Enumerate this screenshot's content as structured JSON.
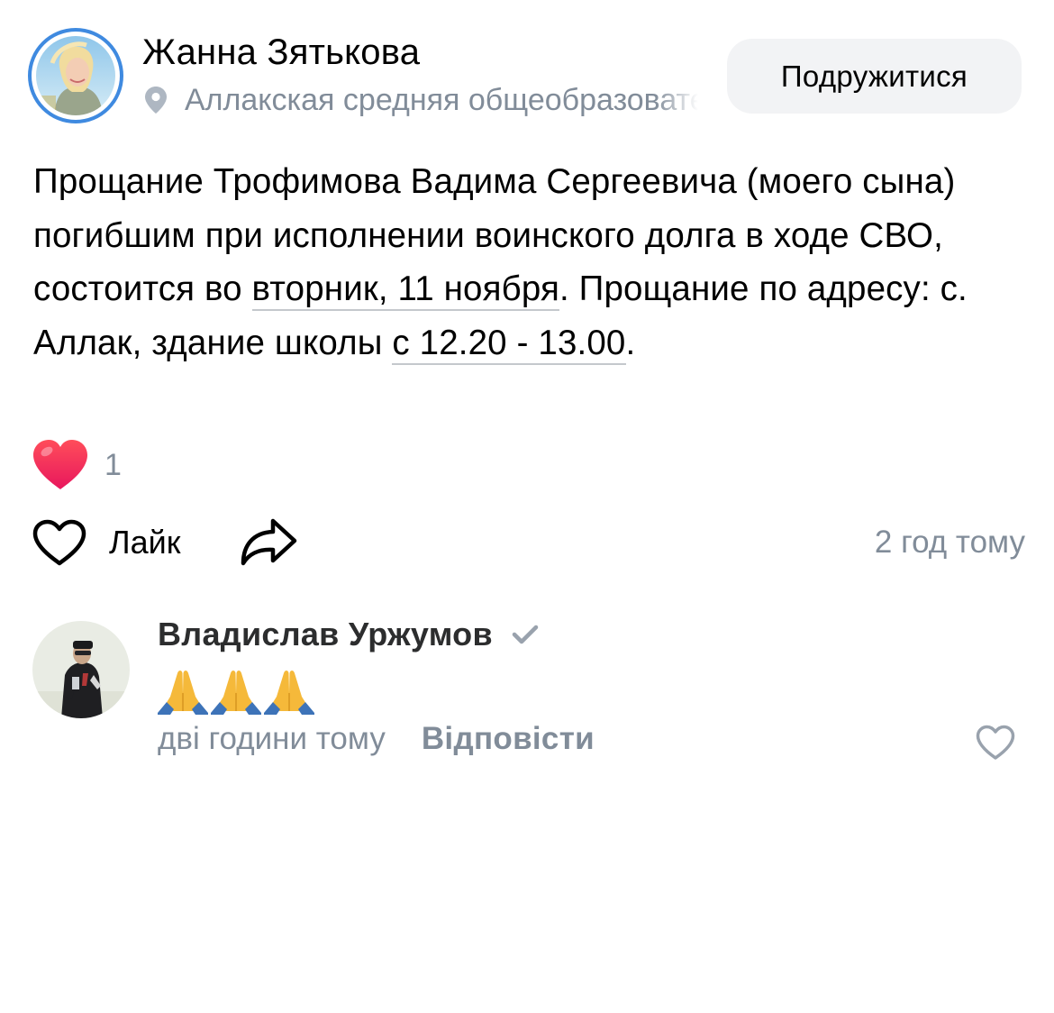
{
  "post": {
    "author": {
      "name": "Жанна Зятькова",
      "location": "Аллакская средняя общеобразовательная школа",
      "avatar_icon": "user-photo-avatar"
    },
    "friend_button_label": "Подружитися",
    "text": {
      "line1": "Прощание Трофимова Вадима Сергеевича (моего сына) погибшим при исполнении воинского долга в ходе СВО, состоится во ",
      "date_link": "вторник, 11 ноября",
      "after_date": ". Прощание по адресу: с. Аллак, здание школы ",
      "time_link": "с 12.20 - 13.00",
      "end": "."
    },
    "reactions": {
      "icon": "heart-reaction-icon",
      "count": "1"
    },
    "actions": {
      "like_label": "Лайк",
      "like_icon": "heart-outline-icon",
      "share_icon": "share-arrow-icon",
      "time": "2 год тому"
    }
  },
  "comment": {
    "author_name": "Владислав Уржумов",
    "verified_icon": "checkmark-icon",
    "emoji": [
      "🙏",
      "🙏",
      "🙏"
    ],
    "time": "дві години тому",
    "reply_label": "Відповісти",
    "like_icon": "heart-outline-icon"
  },
  "colors": {
    "secondary_text": "#818c99",
    "avatar_ring": "#3f8ae0",
    "button_bg": "#f2f3f5",
    "heart_red": "#ff3347"
  }
}
